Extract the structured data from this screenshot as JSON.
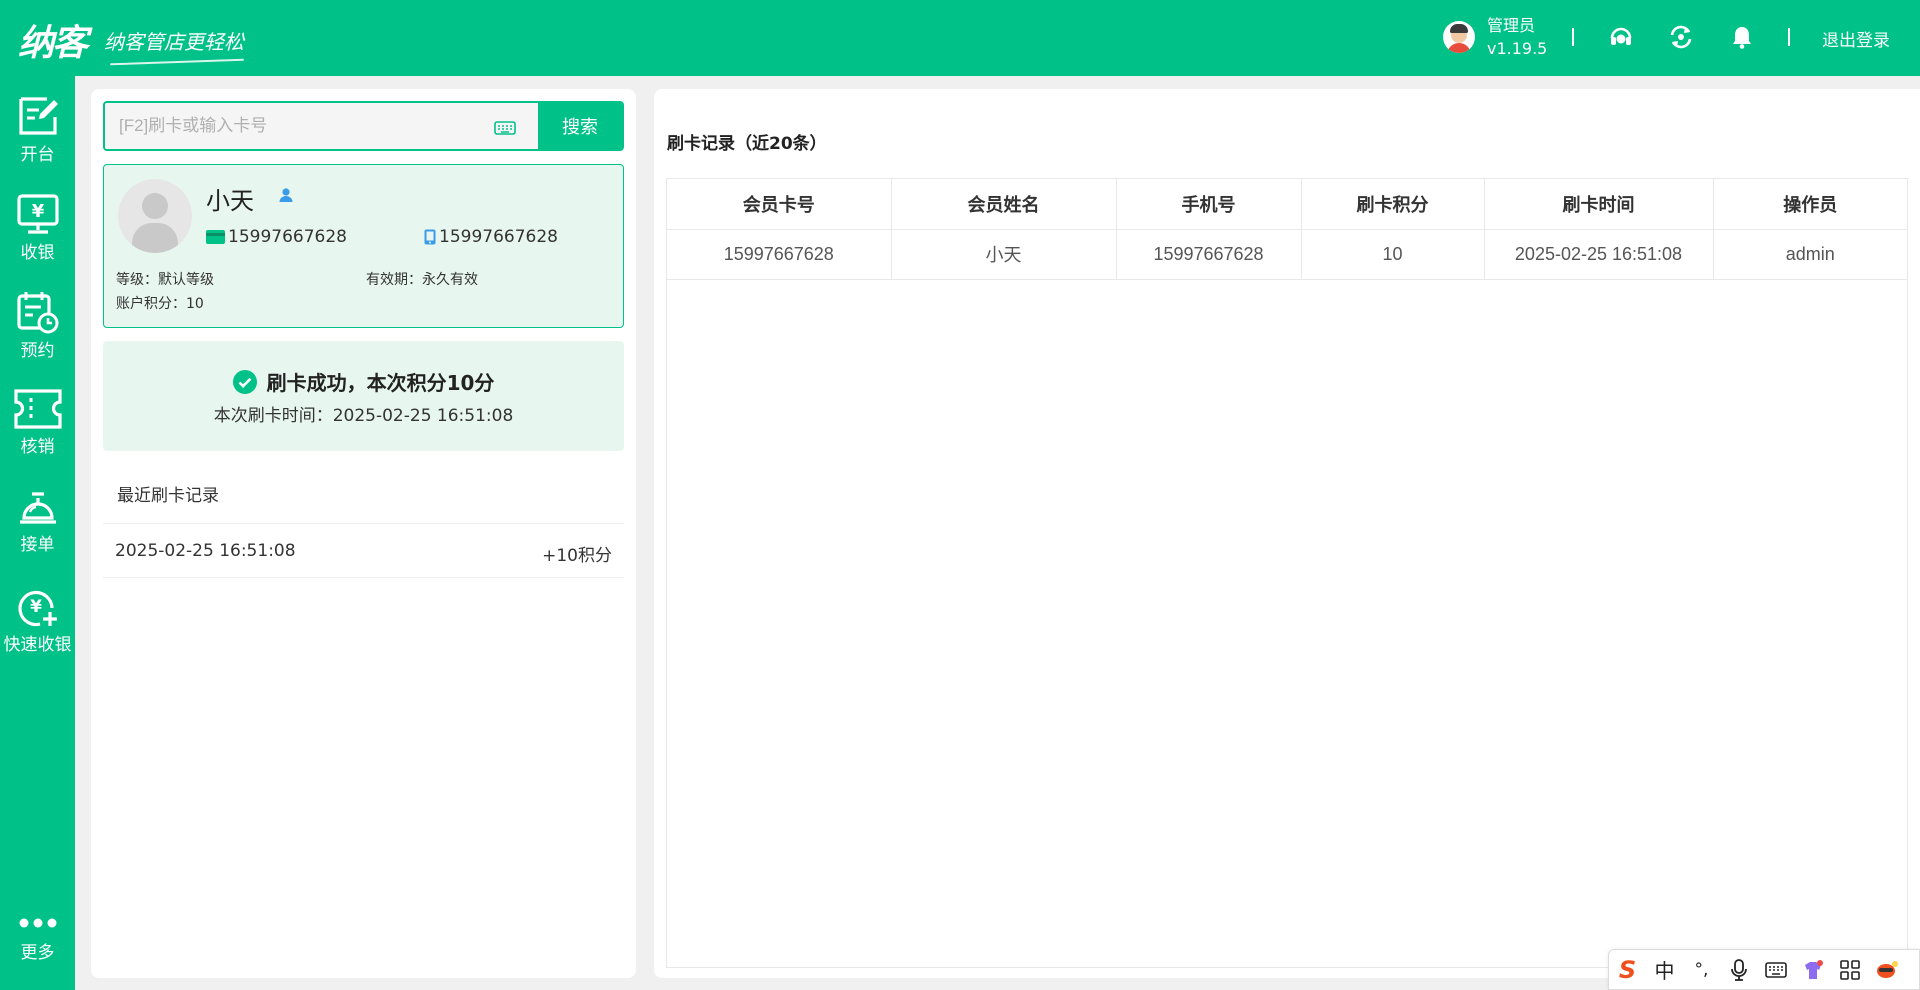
{
  "app": {
    "logo_main": "纳客",
    "slogan": "纳客管店更轻松",
    "user_name": "管理员",
    "version": "v1.19.5",
    "logout_label": "退出登录",
    "brand_color": "#00c187",
    "top_icons": [
      "headset-icon",
      "sync-icon",
      "bell-icon"
    ]
  },
  "sidebar": {
    "items": [
      {
        "label": "开台",
        "icon": "open-table-icon"
      },
      {
        "label": "收银",
        "icon": "cashier-icon"
      },
      {
        "label": "预约",
        "icon": "reservation-icon"
      },
      {
        "label": "核销",
        "icon": "ticket-icon"
      },
      {
        "label": "接单",
        "icon": "service-bell-icon"
      },
      {
        "label": "快速收银",
        "icon": "quick-cashier-icon"
      }
    ],
    "more_label": "更多"
  },
  "search": {
    "placeholder": "[F2]刷卡或输入卡号",
    "value": "",
    "button_label": "搜索"
  },
  "member": {
    "name": "小天",
    "card_no": "15997667628",
    "phone": "15997667628",
    "level_label": "等级：",
    "level_value": "默认等级",
    "validity_label": "有效期：",
    "validity_value": "永久有效",
    "points_label": "账户积分：",
    "points_value": "10"
  },
  "result": {
    "message": "刷卡成功，本次积分10分",
    "time_text": "本次刷卡时间：2025-02-25 16:51:08"
  },
  "recent": {
    "title": "最近刷卡记录",
    "items": [
      {
        "time": "2025-02-25 16:51:08",
        "points": "+10积分"
      }
    ]
  },
  "records": {
    "title": "刷卡记录（近20条）",
    "columns": [
      "会员卡号",
      "会员姓名",
      "手机号",
      "刷卡积分",
      "刷卡时间",
      "操作员"
    ],
    "rows": [
      [
        "15997667628",
        "小天",
        "15997667628",
        "10",
        "2025-02-25 16:51:08",
        "admin"
      ]
    ]
  },
  "ime": {
    "logo": "S",
    "mode": "中",
    "punct": "°,"
  }
}
